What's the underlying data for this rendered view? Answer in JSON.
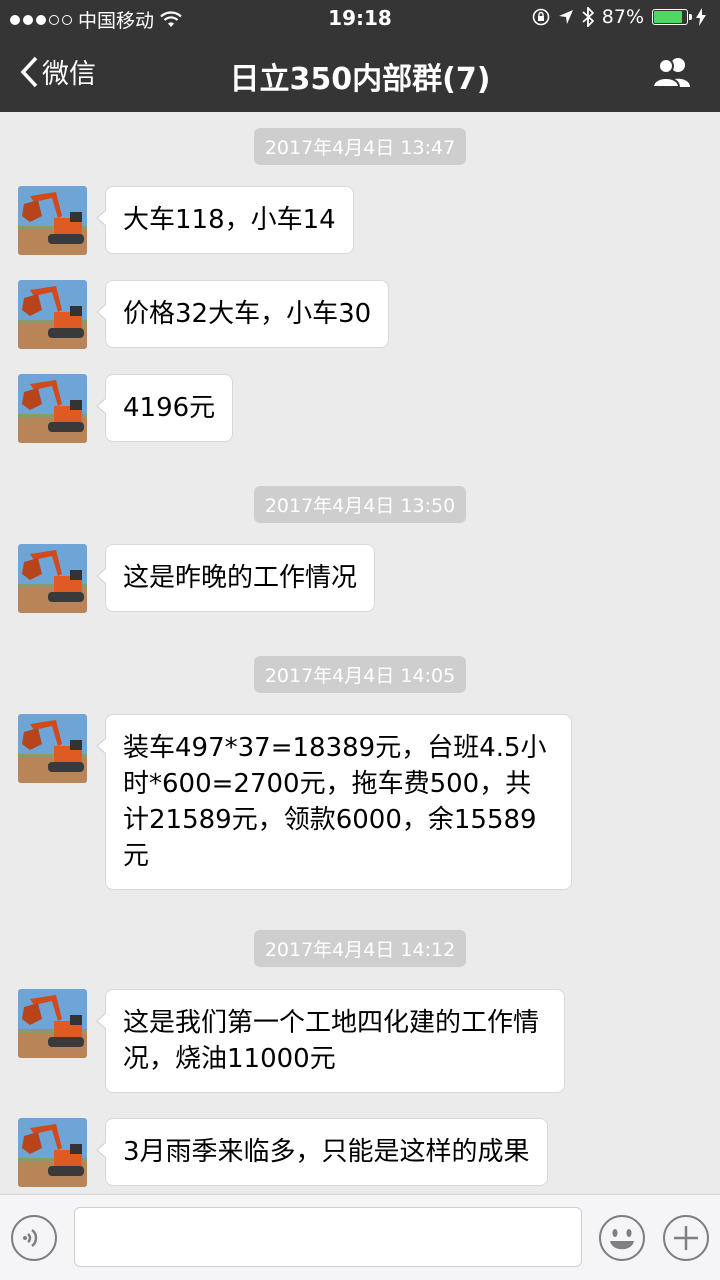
{
  "status_bar": {
    "carrier": "中国移动",
    "time": "19:18",
    "battery": "87%",
    "battery_level": 0.87
  },
  "nav": {
    "back_label": "微信",
    "title": "日立350内部群(7)"
  },
  "messages": [
    {
      "type": "time",
      "text": "2017年4月4日 13:47"
    },
    {
      "type": "msg",
      "text": "大车118，小车14"
    },
    {
      "type": "msg",
      "text": "价格32大车，小车30"
    },
    {
      "type": "msg",
      "text": "4196元"
    },
    {
      "type": "time",
      "text": "2017年4月4日 13:50"
    },
    {
      "type": "msg",
      "text": "这是昨晚的工作情况"
    },
    {
      "type": "time",
      "text": "2017年4月4日 14:05"
    },
    {
      "type": "msg",
      "text": "装车497*37=18389元，台班4.5小时*600=2700元，拖车费500，共计21589元，领款6000，余15589元"
    },
    {
      "type": "time",
      "text": "2017年4月4日 14:12"
    },
    {
      "type": "msg",
      "text": "这是我们第一个工地四化建的工作情况，烧油11000元"
    },
    {
      "type": "msg",
      "text": "3月雨季来临多，只能是这样的成果"
    }
  ],
  "colors": {
    "nav_bg": "#353535",
    "chat_bg": "#ebebeb",
    "battery_green": "#4cd964"
  },
  "icons": [
    "signal-dots-icon",
    "wifi-icon",
    "orientation-lock-icon",
    "location-arrow-icon",
    "bluetooth-icon",
    "battery-icon",
    "charging-bolt-icon",
    "back-chevron-icon",
    "group-members-icon",
    "voice-icon",
    "emoji-icon",
    "plus-icon"
  ]
}
